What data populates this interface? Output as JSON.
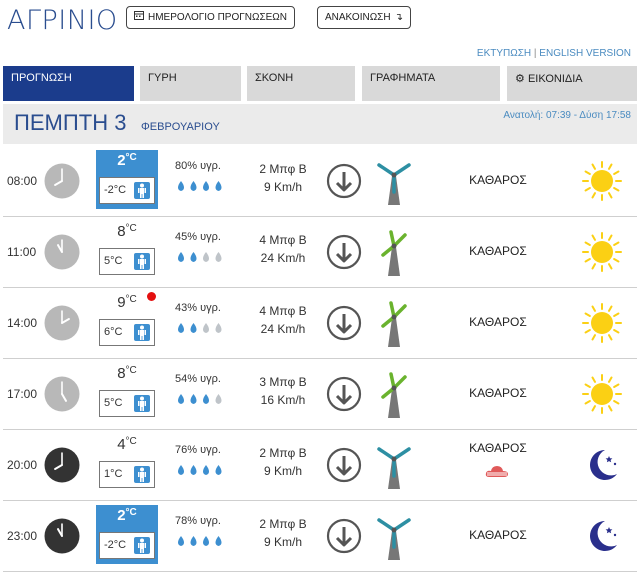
{
  "header": {
    "city": "ΑΓΡΙΝΙΟ",
    "calendar_button": "ΗΜΕΡΟΛΟΓΙΟ ΠΡΟΓΝΩΣΕΩΝ",
    "refresh_button": "ΑΝΑΚΟΙΝΩΣΗ",
    "print_link": "ΕΚΤΥΠΩΣΗ",
    "separator": "|",
    "english_link": "ENGLISH VERSION"
  },
  "tabs": [
    {
      "label": "ΠΡΟΓΝΩΣΗ",
      "active": true
    },
    {
      "label": "ΓΥΡΗ",
      "active": false
    },
    {
      "label": "ΣΚΟΝΗ",
      "active": false
    },
    {
      "label": "ΓΡΑΦΗΜΑΤΑ",
      "active": false
    },
    {
      "label": "ΕΙΚΟΝΙΔΙΑ",
      "active": false,
      "icon": "gear-icon"
    }
  ],
  "day": {
    "name": "ΠΕΜΠΤΗ 3",
    "month": "ΦΕΒΡΟΥΑΡΙΟΥ",
    "sun_times": "Ανατολή: 07:39  - Δύση 17:58"
  },
  "colors": {
    "brand_blue": "#1b3c8c",
    "accent_blue": "#3d8fd0",
    "tab_gray": "#d9d9d9",
    "drop_blue": "#3d8fd0",
    "drop_gray": "#bfc4c9",
    "sun_yellow": "#fbd014",
    "moon_navy": "#2a2f8c",
    "turbine_green": "#6ab32e",
    "turbine_teal": "#2d8fa3"
  },
  "units": {
    "deg": "°C"
  },
  "rows": [
    {
      "time": "08:00",
      "clock_dark": false,
      "temp": "2",
      "feels": "-2°C",
      "highlight": true,
      "red_dot": false,
      "humidity": "80% υγρ.",
      "drops_filled": 4,
      "wind_bf": "2 Μπφ Β",
      "wind_kmh": "9 Km/h",
      "turbine": "still",
      "description": "ΚΑΘΑΡΟΣ",
      "cloud": false,
      "icon": "sun-icon"
    },
    {
      "time": "11:00",
      "clock_dark": false,
      "temp": "8",
      "feels": "5°C",
      "highlight": false,
      "red_dot": false,
      "humidity": "45% υγρ.",
      "drops_filled": 2,
      "wind_bf": "4 Μπφ Β",
      "wind_kmh": "24 Km/h",
      "turbine": "spinning",
      "description": "ΚΑΘΑΡΟΣ",
      "cloud": false,
      "icon": "sun-icon"
    },
    {
      "time": "14:00",
      "clock_dark": false,
      "temp": "9",
      "feels": "6°C",
      "highlight": false,
      "red_dot": true,
      "humidity": "43% υγρ.",
      "drops_filled": 2,
      "wind_bf": "4 Μπφ Β",
      "wind_kmh": "24 Km/h",
      "turbine": "spinning",
      "description": "ΚΑΘΑΡΟΣ",
      "cloud": false,
      "icon": "sun-icon"
    },
    {
      "time": "17:00",
      "clock_dark": false,
      "temp": "8",
      "feels": "5°C",
      "highlight": false,
      "red_dot": false,
      "humidity": "54% υγρ.",
      "drops_filled": 3,
      "wind_bf": "3 Μπφ Β",
      "wind_kmh": "16 Km/h",
      "turbine": "spinning",
      "description": "ΚΑΘΑΡΟΣ",
      "cloud": false,
      "icon": "sun-icon"
    },
    {
      "time": "20:00",
      "clock_dark": true,
      "temp": "4",
      "feels": "1°C",
      "highlight": false,
      "red_dot": false,
      "humidity": "76% υγρ.",
      "drops_filled": 4,
      "wind_bf": "2 Μπφ Β",
      "wind_kmh": "9 Km/h",
      "turbine": "still",
      "description": "ΚΑΘΑΡΟΣ",
      "cloud": true,
      "icon": "moon-icon"
    },
    {
      "time": "23:00",
      "clock_dark": true,
      "temp": "2",
      "feels": "-2°C",
      "highlight": true,
      "red_dot": false,
      "humidity": "78% υγρ.",
      "drops_filled": 4,
      "wind_bf": "2 Μπφ Β",
      "wind_kmh": "9 Km/h",
      "turbine": "still",
      "description": "ΚΑΘΑΡΟΣ",
      "cloud": false,
      "icon": "moon-icon"
    }
  ]
}
